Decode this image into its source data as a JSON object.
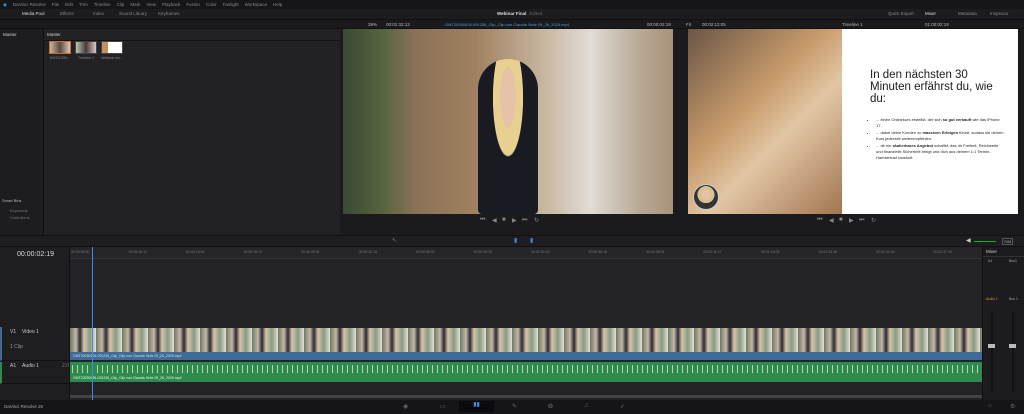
{
  "app": {
    "menu": [
      "DaVinci Resolve",
      "File",
      "Edit",
      "Trim",
      "Timeline",
      "Clip",
      "Mark",
      "View",
      "Playback",
      "Fusion",
      "Color",
      "Fairlight",
      "Workspace",
      "Help"
    ],
    "project_title": "Webinar Final",
    "project_status": "Edited",
    "product": "DaVinci Resolve 20"
  },
  "toolbar": {
    "left": [
      "Media Pool",
      "Effects",
      "Index",
      "Sound Library",
      "Keyframes"
    ],
    "right": [
      "Quick Export",
      "Mixer",
      "Metadata",
      "Inspector"
    ]
  },
  "source_viewer": {
    "zoom": "39%",
    "duration": "00:01:32:13",
    "clip_name": "GMT20250926-091236_Clip_Clip von Claudia Seitz 09_26_2025.mp4",
    "timecode": "00:00:02:19"
  },
  "timeline_viewer": {
    "zoom": "Fit",
    "duration": "00:02:12:05",
    "timeline_name": "Timeline 1",
    "timecode": "01:00:02:19"
  },
  "media_pool": {
    "sidebar_header": "Master",
    "bin_header": "Master",
    "clips": [
      "GMT20250...",
      "Timeline 1",
      "Webinar sin..."
    ],
    "smart_bins": "Smart Bins",
    "smart_items": [
      "Keywords",
      "Collections"
    ]
  },
  "slide": {
    "heading": "In den nächsten 30 Minuten erfährst du, wie du:",
    "bullets": [
      {
        "pre": "... einen Onlinekurs erstellst, der sich ",
        "bold": "so gut verkauft",
        "post": " wie das iPhone 17."
      },
      {
        "pre": "... dabei deine Kunden zu ",
        "bold": "massiven Erfolgen",
        "post": " führst, sodass sie deinen Kurs jederzeit weiterempfehlen."
      },
      {
        "pre": "... dir ein ",
        "bold": "skalierbares Angebot",
        "post": " schaffst, das dir Freiheit, Reichweite und finanzielle Sicherheit bringt und dich aus deinem 1:1 Termin-Hamsterrad rausholt."
      }
    ]
  },
  "timeline": {
    "timecode": "00:00:02:19",
    "ruler": [
      "00:00:00:00",
      "00:00:06:12",
      "00:00:13:00",
      "00:00:19:13",
      "00:00:26:01",
      "00:00:32:14",
      "00:00:39:02",
      "00:00:45:15",
      "00:00:52:03",
      "00:00:58:16",
      "00:01:05:04",
      "00:01:11:17",
      "00:01:18:05",
      "00:01:24:18",
      "00:01:31:06",
      "00:01:37:19"
    ],
    "video_track": {
      "id": "V1",
      "name": "Video 1",
      "count": "1 Clip",
      "clip": "GMT20250926-091236_Clip_Clip von Claudia Seitz 09_26_2025.mp4"
    },
    "audio_track": {
      "id": "A1",
      "name": "Audio 1",
      "channels": "2.0",
      "clip": "GMT20250926-091236_Clip_Clip von Claudia Seitz 09_26_2025.mp4"
    },
    "dim": "DIM"
  },
  "mixer": {
    "title": "Mixer",
    "channels": [
      "A1",
      "Bus1"
    ],
    "labels": [
      "Audio 1",
      "Bus 1"
    ],
    "scale": [
      "0",
      "-5",
      "-10",
      "-15",
      "-20",
      "-30",
      "-40",
      "-50"
    ]
  },
  "colors": {
    "accent": "#3a8ee6",
    "video_clip": "#3e6c98",
    "audio_clip": "#2f8a4c"
  }
}
